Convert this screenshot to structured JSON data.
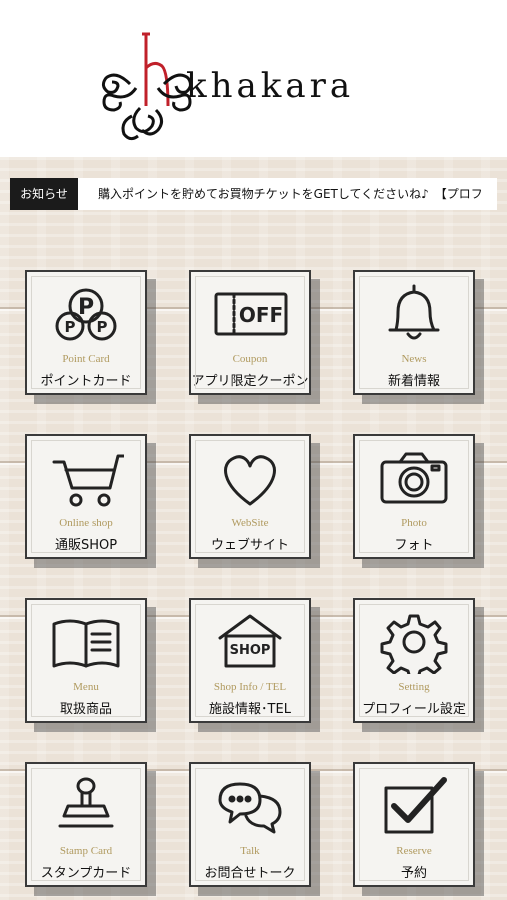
{
  "header": {
    "logo_text": "khakara"
  },
  "notice": {
    "label": "お知らせ",
    "text": "購入ポイントを貯めてお買物チケットをGETしてくださいね♪　【プロフ"
  },
  "menu": [
    {
      "en": "Point Card",
      "jp": "ポイントカード",
      "icon": "point-card-icon"
    },
    {
      "en": "Coupon",
      "jp": "アプリ限定クーポン",
      "icon": "coupon-off-icon"
    },
    {
      "en": "News",
      "jp": "新着情報",
      "icon": "bell-icon"
    },
    {
      "en": "Online shop",
      "jp": "通販SHOP",
      "icon": "cart-icon"
    },
    {
      "en": "WebSite",
      "jp": "ウェブサイト",
      "icon": "heart-icon"
    },
    {
      "en": "Photo",
      "jp": "フォト",
      "icon": "camera-icon"
    },
    {
      "en": "Menu",
      "jp": "取扱商品",
      "icon": "book-icon"
    },
    {
      "en": "Shop Info / TEL",
      "jp": "施設情報･TEL",
      "icon": "shop-icon"
    },
    {
      "en": "Setting",
      "jp": "プロフィール設定",
      "icon": "gear-icon"
    },
    {
      "en": "Stamp Card",
      "jp": "スタンプカード",
      "icon": "stamp-icon"
    },
    {
      "en": "Talk",
      "jp": "お問合せトーク",
      "icon": "chat-icon"
    },
    {
      "en": "Reserve",
      "jp": "予約",
      "icon": "checkbox-icon"
    }
  ],
  "icon_svg": {
    "point-card-icon": "<circle cx='38' cy='24' r='16'/><circle cx='22' cy='44' r='13'/><circle cx='54' cy='44' r='13'/><text x='38' y='32' font-size='22' font-weight='bold' text-anchor='middle' fill='#222' stroke='none' font-family='DejaVu Sans'>P</text><text x='22' y='50' font-size='15' font-weight='bold' text-anchor='middle' fill='#222' stroke='none' font-family='DejaVu Sans'>P</text><text x='54' y='50' font-size='15' font-weight='bold' text-anchor='middle' fill='#222' stroke='none' font-family='DejaVu Sans'>P</text>",
    "coupon-off-icon": "<rect x='4' y='12' width='70' height='40' rx='2'/><line x1='22' y1='12' x2='22' y2='52' stroke-dasharray='3 3'/><text x='49' y='40' font-size='20' font-weight='bold' text-anchor='middle' fill='#222' stroke='none' font-family='DejaVu Sans'>OFF</text>",
    "bell-icon": "<path d='M20 48 Q22 40 22 30 Q22 12 38 10 Q54 12 54 30 Q54 40 58 48 Z'/><line x1='14' y1='48' x2='62' y2='48'/><path d='M32 52 Q38 60 44 52'/><line x1='38' y1='4' x2='38' y2='10'/>",
    "cart-icon": "<path d='M6 16 L16 16 L24 42 L62 42 L70 10 L76 10'/><path d='M18 24 L66 24'/><circle cx='28' cy='54' r='5'/><circle cx='56' cy='54' r='5'/>",
    "heart-icon": "<path d='M38 58 C10 38 8 18 22 12 C30 8 36 14 38 20 C40 14 46 8 54 12 C68 18 66 38 38 58 Z'/>",
    "camera-icon": "<rect x='6' y='16' width='64' height='40' rx='4'/><path d='M24 16 L30 8 L46 8 L52 16'/><circle cx='38' cy='36' r='14'/><circle cx='38' cy='36' r='8'/><rect x='56' y='20' width='7' height='4'/>",
    "book-icon": "<path d='M38 14 Q22 8 6 14 L6 56 Q22 50 38 56 Q54 50 70 56 L70 14 Q54 8 38 14 Z'/><line x1='38' y1='14' x2='38' y2='56'/><line x1='44' y1='24' x2='62' y2='24'/><line x1='44' y1='32' x2='62' y2='32'/><line x1='44' y1='40' x2='62' y2='40'/>",
    "shop-icon": "<path d='M8 28 L38 6 L68 28'/><rect x='14' y='26' width='48' height='30'/><text x='38' y='44' font-size='13' font-weight='bold' text-anchor='middle' fill='#222' stroke='none' font-family='DejaVu Sans'>SHOP</text>",
    "gear-icon": "<circle cx='38' cy='32' r='10'/><path d='M34 6 L42 6 L44 14 L52 17 L59 12 L64 18 L59 25 L62 32 L70 34 L70 42 L62 44 L59 51 L64 58 L58 63 L51 58 L44 61 L42 68 L34 68 L32 61 L25 58 L18 63 L12 58 L17 51 L14 44 L6 42 L6 34 L14 32 L17 25 L12 18 L18 12 L25 17 L32 14 Z'/>",
    "stamp-icon": "<ellipse cx='38' cy='12' rx='8' ry='7'/><path d='M34 19 L34 32 L42 32 L42 19'/><path d='M20 32 L56 32 L60 42 L16 42 Z'/><line x1='12' y1='52' x2='64' y2='52'/>",
    "chat-icon": "<path d='M8 26 Q8 10 28 10 Q48 10 48 26 Q48 40 28 40 L18 48 L20 38 Q8 34 8 26 Z'/><circle cx='20' cy='25' r='2' fill='#222'/><circle cx='28' cy='25' r='2' fill='#222'/><circle cx='36' cy='25' r='2' fill='#222'/><path d='M48 22 Q68 24 68 38 Q68 46 60 50 L62 58 L52 52 Q38 52 34 42'/>",
    "checkbox-icon": "<rect x='10' y='14' width='46' height='44'/><path d='M18 32 L32 46 L68 6' stroke-width='6'/>"
  },
  "colors": {
    "notice_label_bg": "#1b1b1b",
    "tile_en_text": "#b09a5f",
    "logo_accent": "#c0202a"
  }
}
